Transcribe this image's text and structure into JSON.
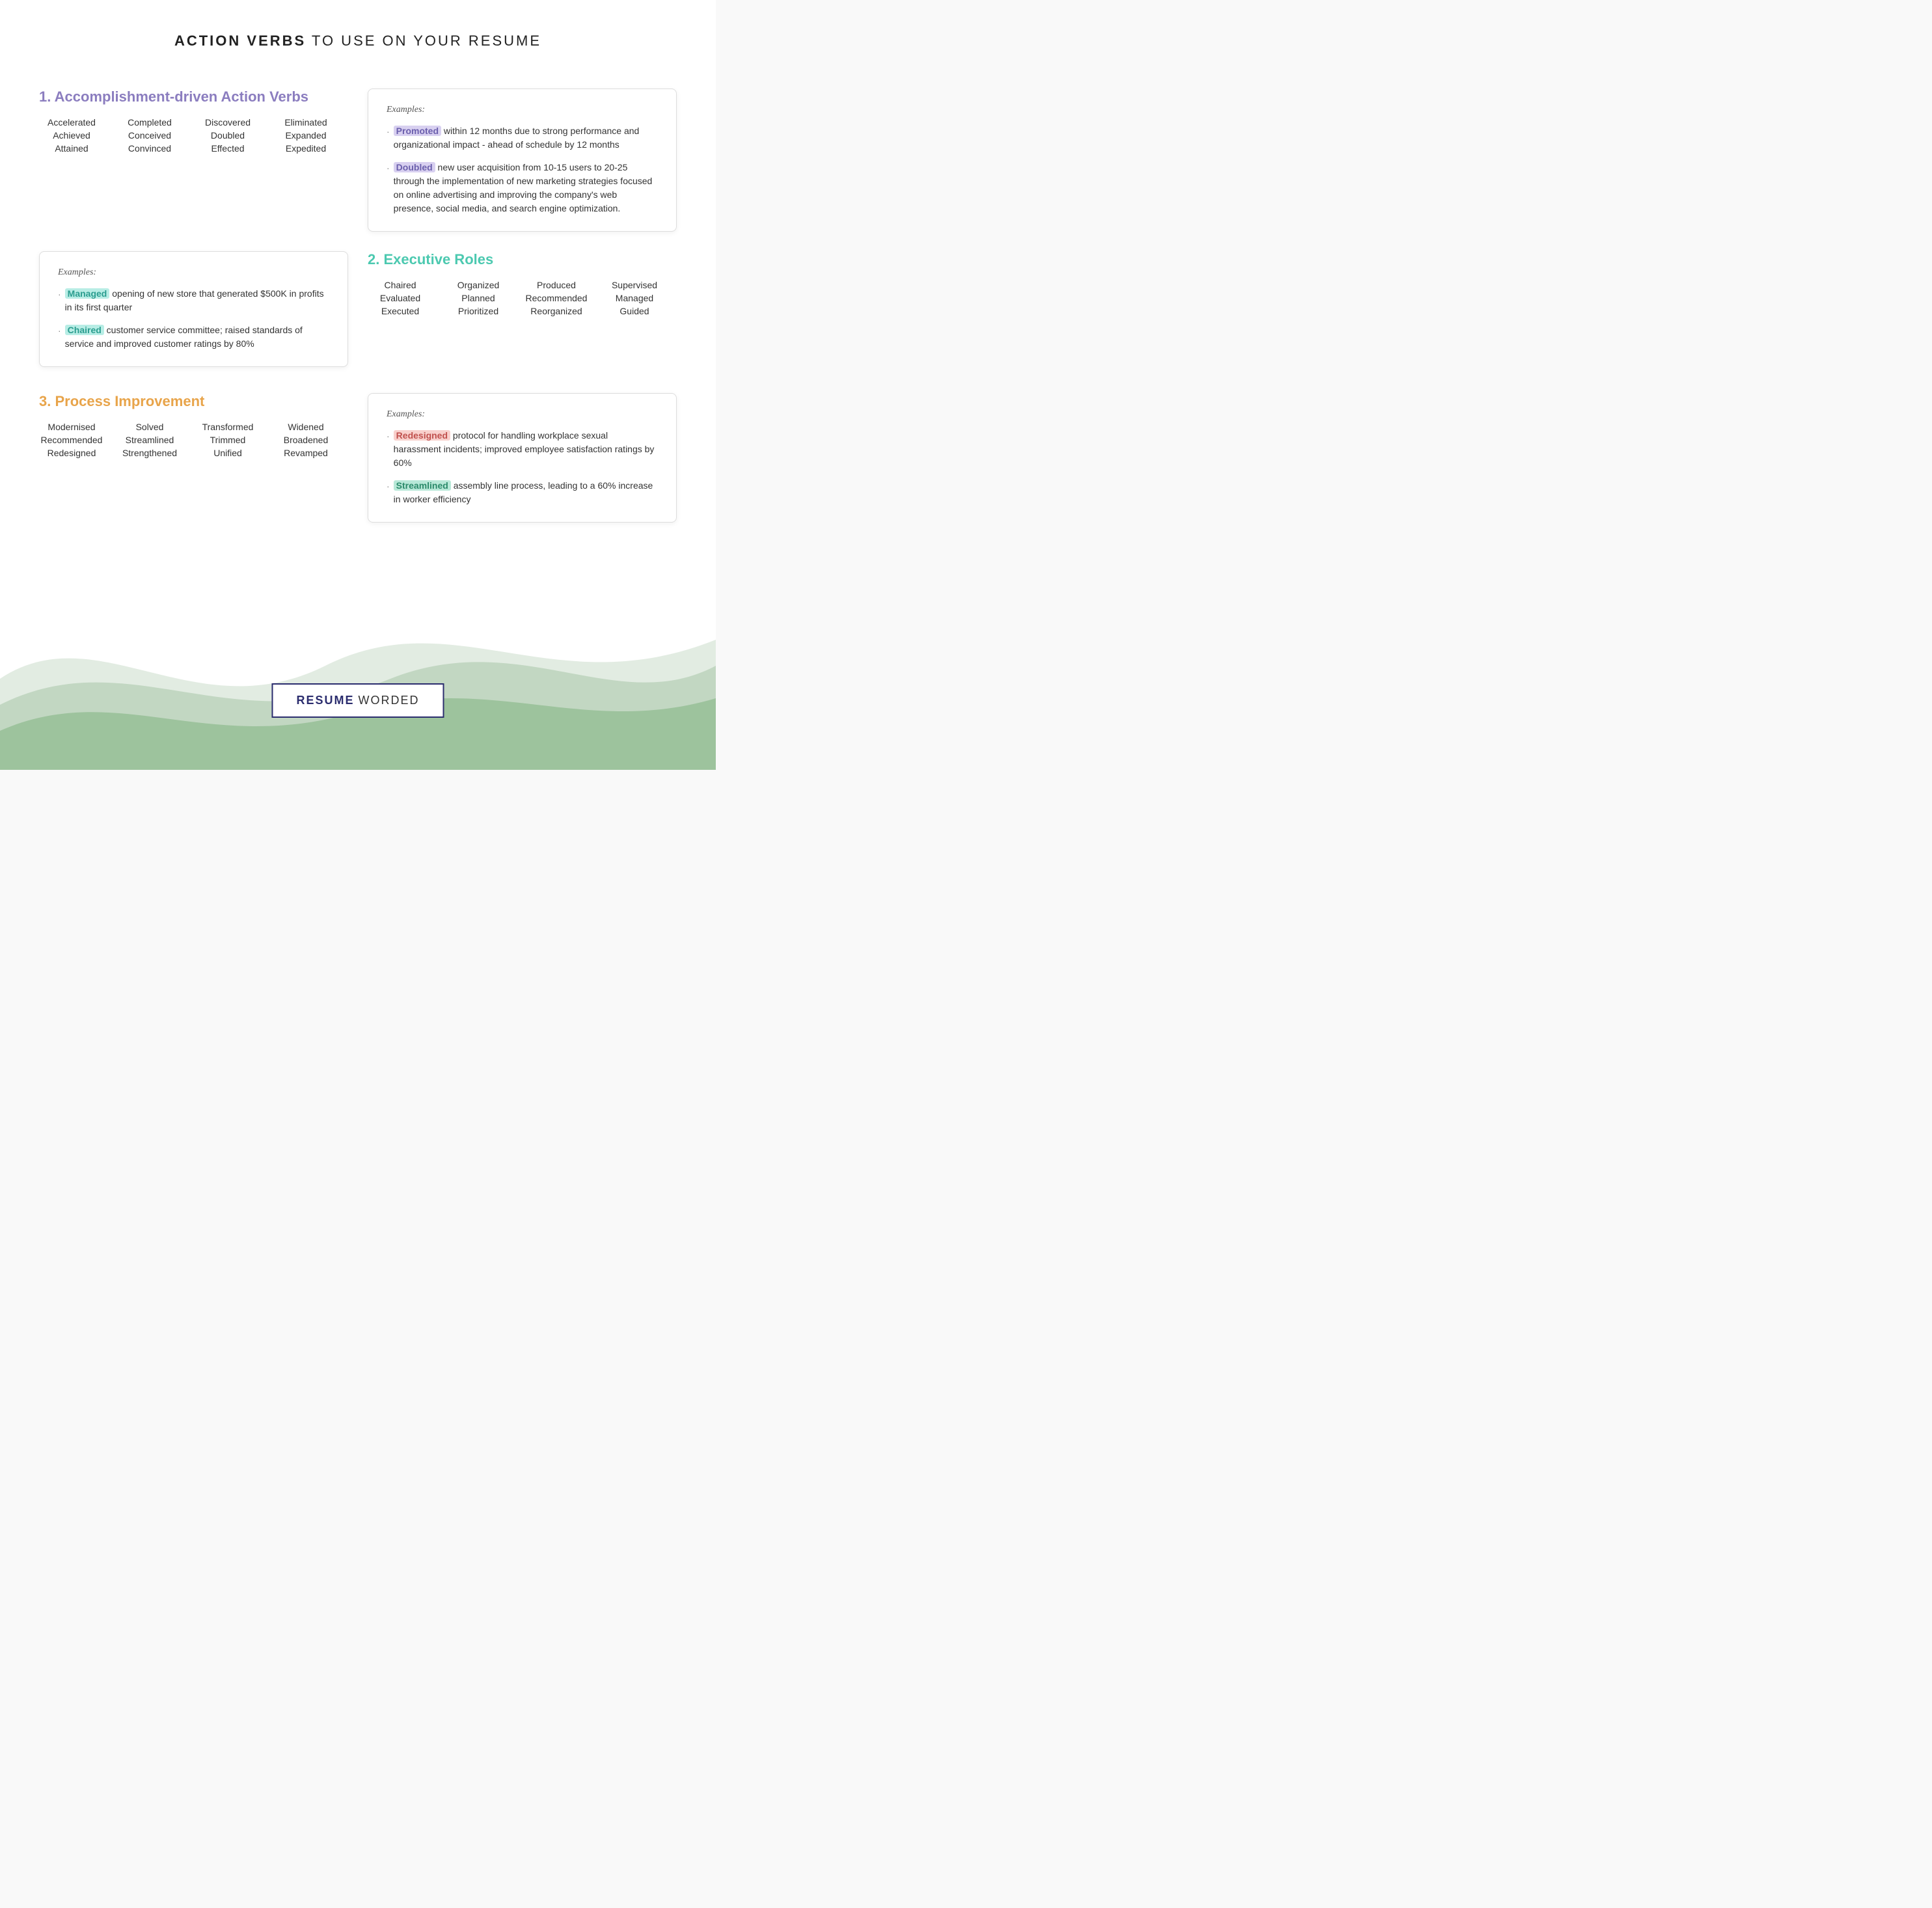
{
  "header": {
    "bold": "ACTION VERBS",
    "rest": " TO USE ON YOUR RESUME"
  },
  "section1": {
    "title": "1. Accomplishment-driven Action Verbs",
    "titleColor": "purple",
    "columns": [
      [
        "Accelerated",
        "Achieved",
        "Attained"
      ],
      [
        "Completed",
        "Conceived",
        "Convinced"
      ],
      [
        "Discovered",
        "Doubled",
        "Effected"
      ],
      [
        "Eliminated",
        "Expanded",
        "Expedited"
      ]
    ],
    "examples_label": "Examples:",
    "examples": [
      {
        "highlight": "Promoted",
        "highlight_class": "purple-hl",
        "text": " within 12 months due to strong performance and organizational impact - ahead of schedule by 12 months"
      },
      {
        "highlight": "Doubled",
        "highlight_class": "purple-hl",
        "text": " new user acquisition from 10-15 users to 20-25 through the implementation of new marketing strategies focused on online advertising and improving the company's web presence, social media, and search engine optimization."
      }
    ]
  },
  "section1_card2": {
    "examples_label": "Examples:",
    "examples": [
      {
        "highlight": "Managed",
        "highlight_class": "teal-hl",
        "text": " opening of new store that generated $500K in profits in its first quarter"
      },
      {
        "highlight": "Chaired",
        "highlight_class": "teal-hl",
        "text": " customer service committee; raised standards of service and improved customer ratings by 80%"
      }
    ]
  },
  "section2": {
    "title": "2. Executive Roles",
    "titleColor": "teal",
    "columns": [
      [
        "Chaired",
        "Evaluated",
        "Executed"
      ],
      [
        "Organized",
        "Planned",
        "Prioritized"
      ],
      [
        "Produced",
        "Recommended",
        "Reorganized"
      ],
      [
        "Supervised",
        "Managed",
        "Guided"
      ]
    ]
  },
  "section3": {
    "title": "3. Process Improvement",
    "titleColor": "orange",
    "columns": [
      [
        "Modernised",
        "Recommended",
        "Redesigned"
      ],
      [
        "Solved",
        "Streamlined",
        "Strengthened"
      ],
      [
        "Transformed",
        "Trimmed",
        "Unified"
      ],
      [
        "Widened",
        "Broadened",
        "Revamped"
      ]
    ],
    "examples_label": "Examples:",
    "examples": [
      {
        "highlight": "Redesigned",
        "highlight_class": "pink-hl",
        "text": " protocol for handling workplace sexual harassment incidents; improved employee satisfaction ratings by 60%"
      },
      {
        "highlight": "Streamlined",
        "highlight_class": "green-hl",
        "text": " assembly line process, leading to a 60% increase in worker efficiency"
      }
    ]
  },
  "brand": {
    "resume": "RESUME",
    "worded": "WORDED"
  }
}
